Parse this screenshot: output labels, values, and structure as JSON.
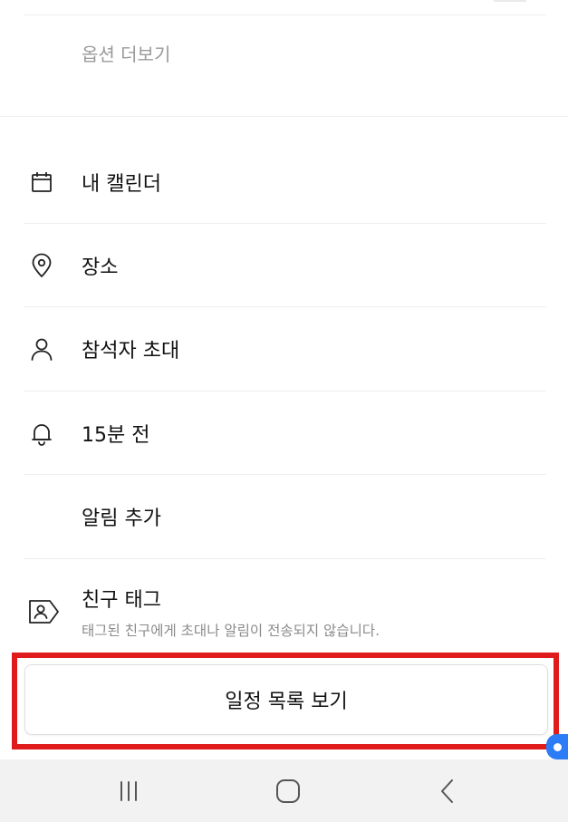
{
  "options": {
    "more_label": "옵션 더보기"
  },
  "menu": {
    "items": [
      {
        "id": "calendar",
        "label": "내 캘린더",
        "icon": "calendar-icon"
      },
      {
        "id": "location",
        "label": "장소",
        "icon": "location-pin-icon"
      },
      {
        "id": "attendees",
        "label": "참석자 초대",
        "icon": "person-icon"
      },
      {
        "id": "reminder",
        "label": "15분 전",
        "icon": "bell-icon"
      },
      {
        "id": "add-reminder",
        "label": "알림 추가",
        "icon": ""
      }
    ]
  },
  "friend_tag": {
    "label": "친구 태그",
    "note": "태그된 친구에게 초대나 알림이 전송되지 않습니다.",
    "icon": "friend-tag-icon"
  },
  "schedule_button": {
    "label": "일정 목록 보기"
  },
  "navigation": {
    "recent": "recent-apps-icon",
    "home": "home-icon",
    "back": "back-icon"
  },
  "colors": {
    "highlight": "#e01b1b",
    "nav_bg": "#f2f2f2",
    "muted_text": "#9a9a9a",
    "accent_chip": "#2b7cf6"
  }
}
